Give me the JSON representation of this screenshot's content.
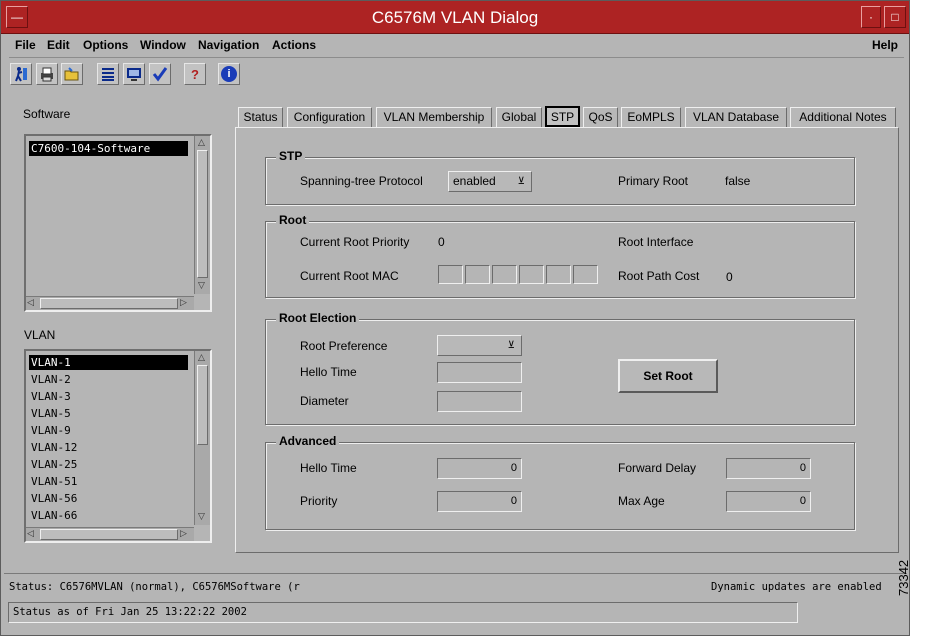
{
  "window": {
    "title": "C6576M VLAN Dialog"
  },
  "menubar": {
    "items": [
      {
        "label": "File"
      },
      {
        "label": "Edit"
      },
      {
        "label": "Options"
      },
      {
        "label": "Window"
      },
      {
        "label": "Navigation"
      },
      {
        "label": "Actions"
      }
    ],
    "help": "Help"
  },
  "toolbar": {
    "icons": [
      "figure-run-icon",
      "printer-icon",
      "folder-open-icon",
      "list-icon",
      "monitor-icon",
      "checkmark-icon",
      "help-question-icon",
      "info-icon"
    ],
    "help_glyph": "?",
    "info_glyph": "i"
  },
  "software": {
    "label": "Software",
    "items": [
      {
        "text": "C7600-104-Software",
        "selected": true
      }
    ]
  },
  "vlan": {
    "label": "VLAN",
    "items": [
      {
        "text": "VLAN-1",
        "selected": true
      },
      {
        "text": "VLAN-2"
      },
      {
        "text": "VLAN-3"
      },
      {
        "text": "VLAN-5"
      },
      {
        "text": "VLAN-9"
      },
      {
        "text": "VLAN-12"
      },
      {
        "text": "VLAN-25"
      },
      {
        "text": "VLAN-51"
      },
      {
        "text": "VLAN-56"
      },
      {
        "text": "VLAN-66"
      }
    ]
  },
  "tabs": [
    {
      "label": "Status"
    },
    {
      "label": "Configuration"
    },
    {
      "label": "VLAN Membership"
    },
    {
      "label": "Global"
    },
    {
      "label": "STP",
      "active": true
    },
    {
      "label": "QoS"
    },
    {
      "label": "EoMPLS"
    },
    {
      "label": "VLAN Database"
    },
    {
      "label": "Additional Notes"
    }
  ],
  "stp": {
    "title": "STP",
    "protocol_label": "Spanning-tree Protocol",
    "protocol_value": "enabled",
    "primary_root_label": "Primary Root",
    "primary_root_value": "false"
  },
  "root": {
    "title": "Root",
    "priority_label": "Current Root Priority",
    "priority_value": "0",
    "interface_label": "Root Interface",
    "interface_value": "",
    "mac_label": "Current Root MAC",
    "mac_octets": [
      "",
      "",
      "",
      "",
      "",
      ""
    ],
    "path_cost_label": "Root Path Cost",
    "path_cost_value": "0"
  },
  "root_election": {
    "title": "Root Election",
    "preference_label": "Root Preference",
    "preference_value": "",
    "hello_label": "Hello Time",
    "hello_value": "",
    "diameter_label": "Diameter",
    "diameter_value": "",
    "set_root_label": "Set Root"
  },
  "advanced": {
    "title": "Advanced",
    "hello_label": "Hello Time",
    "hello_value": "0",
    "priority_label": "Priority",
    "priority_value": "0",
    "forward_delay_label": "Forward Delay",
    "forward_delay_value": "0",
    "max_age_label": "Max Age",
    "max_age_value": "0"
  },
  "statusbar": {
    "status": "Status: C6576MVLAN (normal), C6576MSoftware (r",
    "dynamic": "Dynamic updates are enabled",
    "status_as_of": "Status as of Fri Jan 25 13:22:22 2002"
  },
  "figure_number": "73342",
  "colors": {
    "titlebar": "#ad2323",
    "window_bg": "#b5b5b5",
    "selection": "#000000"
  }
}
